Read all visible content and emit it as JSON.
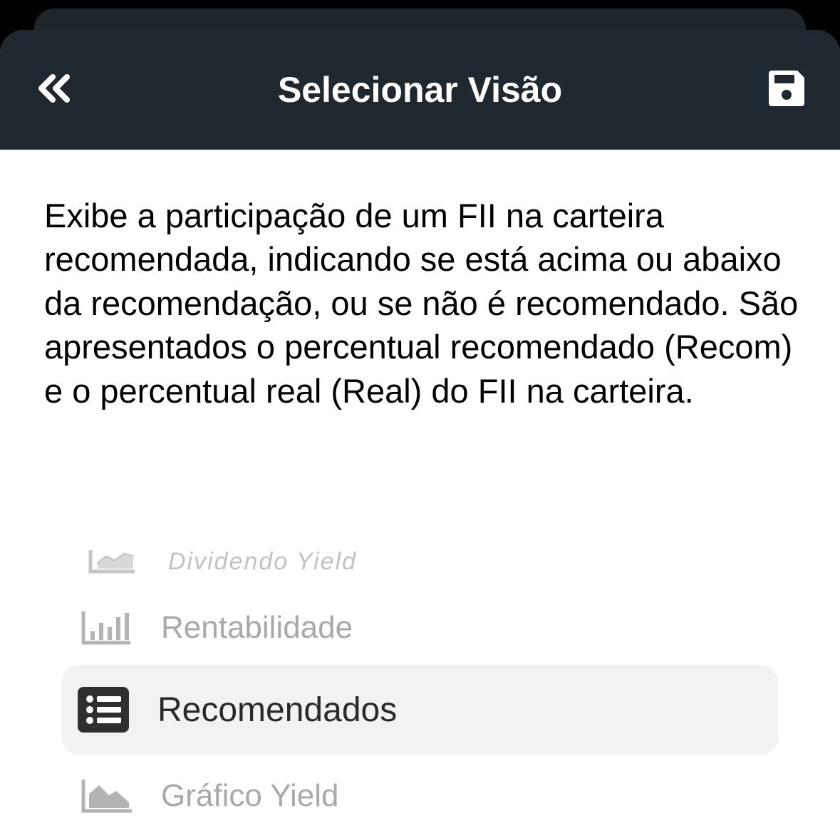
{
  "header": {
    "title": "Selecionar Visão",
    "back_icon": "double-chevron-left-icon",
    "save_icon": "floppy-disk-icon",
    "background_color": "#1f282e"
  },
  "description": "Exibe a participação de um FII na carteira recomendada, indicando se está acima ou abaixo da recomendação, ou se não é recomendado. São apresentados o percentual recomendado (Recom) e o percentual real (Real) do FII na carteira.",
  "picker": {
    "options": [
      {
        "label": "Dividendo Yield",
        "icon": "line-chart-icon",
        "selected": false
      },
      {
        "label": "Rentabilidade",
        "icon": "bar-chart-icon",
        "selected": false
      },
      {
        "label": "Recomendados",
        "icon": "list-icon",
        "selected": true
      },
      {
        "label": "Gráfico Yield",
        "icon": "area-chart-icon",
        "selected": false
      }
    ]
  }
}
